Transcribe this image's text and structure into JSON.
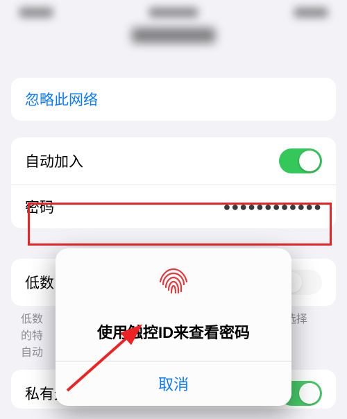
{
  "section_forget": {
    "label": "忽略此网络"
  },
  "section_join": {
    "auto_join_label": "自动加入",
    "auto_join_on": true,
    "password_label": "密码",
    "password_mask": "●●●●●●●●●●●●"
  },
  "section_low": {
    "label_partial": "低数",
    "helper_line1_left": "低数",
    "helper_line1_right": "选择",
    "helper_line2": "的特",
    "helper_line3": "自动"
  },
  "section_private": {
    "label_partial": "私有无线局域网地址"
  },
  "modal": {
    "title": "使用触控ID来查看密码",
    "cancel": "取消"
  },
  "colors": {
    "link": "#0a7aff",
    "toggle_on": "#34c759",
    "danger_highlight": "#e22",
    "fingerprint": "#e5383b"
  }
}
